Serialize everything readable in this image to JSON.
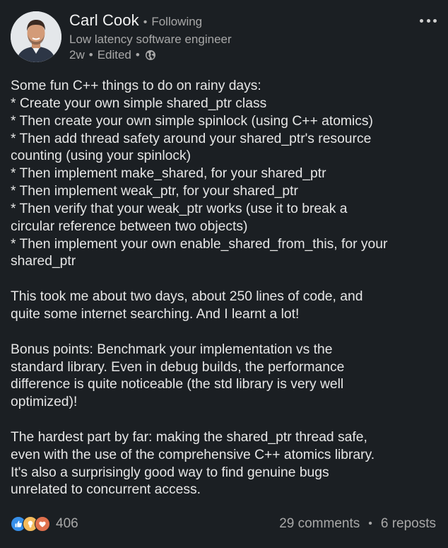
{
  "author": {
    "name": "Carl Cook",
    "follow_status": "Following",
    "headline": "Low latency software engineer",
    "time": "2w",
    "edited": "Edited"
  },
  "icons": {
    "more": "more-horizontal-icon",
    "visibility": "globe-icon",
    "reactions": [
      "like-icon",
      "insightful-icon",
      "love-icon"
    ]
  },
  "post": {
    "lines": [
      "Some fun C++ things to do on rainy days:",
      "* Create your own simple shared_ptr class",
      "* Then create your own simple spinlock (using C++ atomics)",
      "* Then add thread safety around your shared_ptr's resource",
      "counting (using your spinlock)",
      "* Then implement make_shared, for your shared_ptr",
      "* Then implement weak_ptr, for your shared_ptr",
      "* Then verify that your weak_ptr works (use it to break a",
      "circular reference between two objects)",
      "* Then implement your own enable_shared_from_this, for your",
      "shared_ptr",
      "",
      "This took me about two days, about 250 lines of code, and",
      "quite some internet searching. And I learnt a lot!",
      "",
      "Bonus points: Benchmark your implementation vs the",
      "standard library. Even in debug builds, the performance",
      "difference is quite noticeable (the std library is very well",
      "optimized)!",
      "",
      "The hardest part by far: making the shared_ptr thread safe,",
      "even with the use of the comprehensive C++ atomics library.",
      "It's also a surprisingly good way to find genuine bugs",
      "unrelated to concurrent access."
    ]
  },
  "social": {
    "reaction_count": "406",
    "comments": "29 comments",
    "reposts": "6 reposts"
  },
  "colors": {
    "background": "#1b1f23",
    "text": "#e6e6e6",
    "muted": "#a8a8a8",
    "like": "#378fe9",
    "insightful": "#f5bb5c",
    "love": "#df704d"
  }
}
